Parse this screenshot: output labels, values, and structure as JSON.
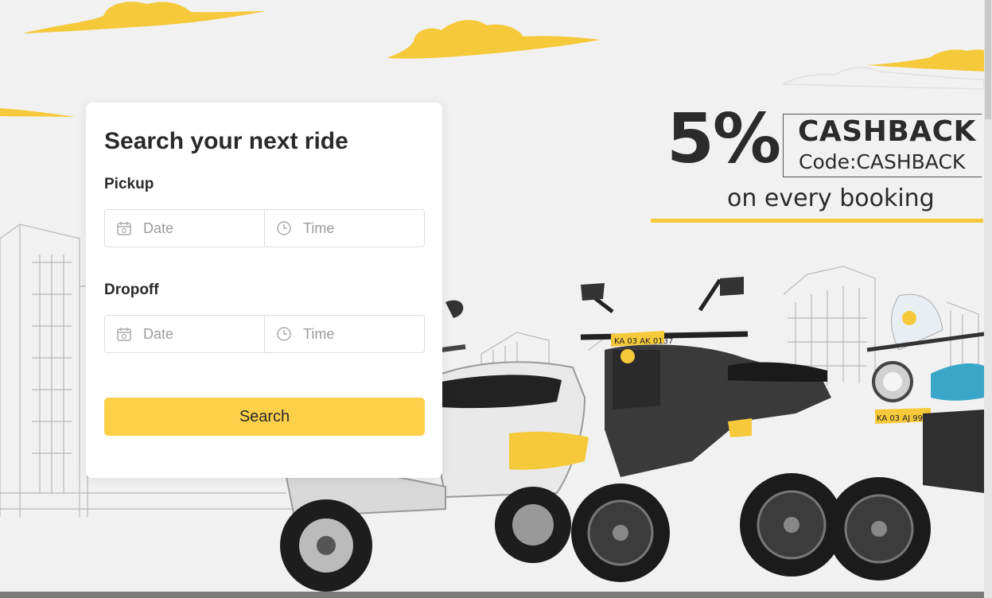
{
  "search_card": {
    "title": "Search your next ride",
    "pickup": {
      "label": "Pickup",
      "date_placeholder": "Date",
      "time_placeholder": "Time"
    },
    "dropoff": {
      "label": "Dropoff",
      "date_placeholder": "Date",
      "time_placeholder": "Time"
    },
    "search_label": "Search"
  },
  "promo": {
    "percent": "5%",
    "title": "CASHBACK",
    "code": "Code:CASHBACK",
    "subtitle": "on every booking"
  },
  "vehicles": {
    "plates": [
      "KA 03 AK 0137",
      "KA 03 AJ 9950"
    ]
  },
  "colors": {
    "accent": "#fdd04a",
    "cloud": "#f6c93b",
    "text": "#2a2a2a"
  },
  "icons": [
    "calendar-icon",
    "clock-icon"
  ]
}
